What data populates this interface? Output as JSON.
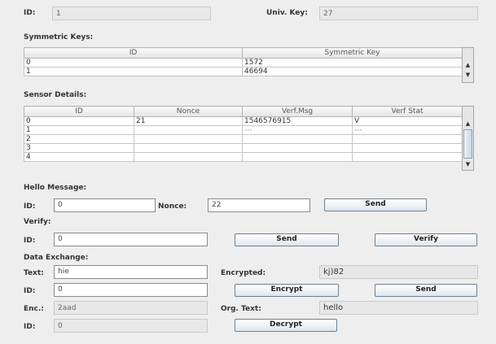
{
  "top": {
    "id_label": "ID:",
    "id_value": "1",
    "univ_key_label": "Univ. Key:",
    "univ_key_value": "27"
  },
  "symmetric_keys": {
    "title": "Symmetric Keys:",
    "columns": [
      "ID",
      "Symmetric Key"
    ],
    "rows": [
      [
        "0",
        "1572"
      ],
      [
        "1",
        "46694"
      ]
    ],
    "scroll_up": "▲",
    "scroll_down": "▼"
  },
  "sensor_details": {
    "title": "Sensor Details:",
    "columns": [
      "ID",
      "Nonce",
      "Verf.Msg",
      "Verf Stat"
    ],
    "rows": [
      [
        "0",
        "21",
        "1546576915",
        "V"
      ],
      [
        "1",
        "",
        "---",
        "---"
      ],
      [
        "2",
        "",
        "",
        ""
      ],
      [
        "3",
        "",
        "",
        ""
      ],
      [
        "4",
        "",
        "",
        ""
      ]
    ],
    "scroll_up": "▲",
    "scroll_down": "▼"
  },
  "hello_message": {
    "title": "Hello Message:",
    "id_label": "ID:",
    "id_value": "0",
    "nonce_label": "Nonce:",
    "nonce_value": "22",
    "send_label": "Send"
  },
  "verify": {
    "title": "Verify:",
    "id_label": "ID:",
    "id_value": "0",
    "send_label": "Send",
    "verify_label": "Verify"
  },
  "data_exchange": {
    "title": "Data Exchange:",
    "text_label": "Text:",
    "text_value": "hie",
    "encrypted_label": "Encrypted:",
    "encrypted_value": "kj)82",
    "id_label": "ID:",
    "id_value": "0",
    "encrypt_label": "Encrypt",
    "send_label": "Send",
    "enc_label": "Enc.:",
    "enc_value": "2aad",
    "org_text_label": "Org. Text:",
    "org_text_value": "hello",
    "id2_label": "ID:",
    "id2_value": "0",
    "decrypt_label": "Decrypt"
  }
}
